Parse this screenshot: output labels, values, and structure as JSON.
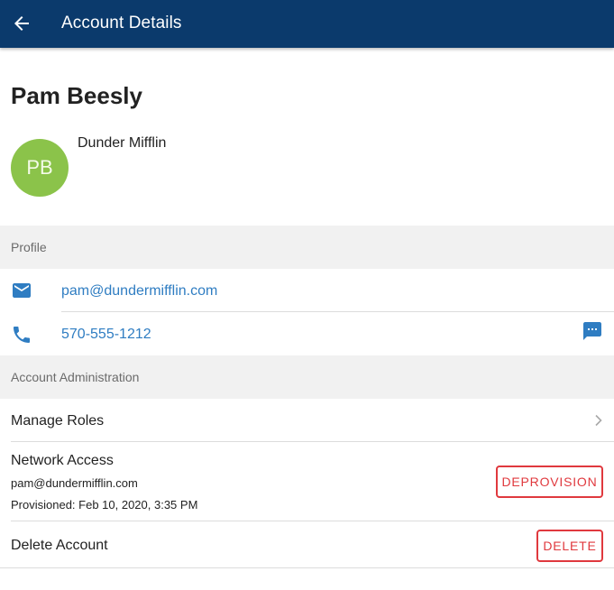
{
  "header": {
    "title": "Account Details"
  },
  "user": {
    "name": "Pam Beesly",
    "initials": "PB",
    "company": "Dunder Mifflin"
  },
  "profile": {
    "section_title": "Profile",
    "email": "pam@dundermifflin.com",
    "phone": "570-555-1212"
  },
  "admin": {
    "section_title": "Account Administration",
    "manage_roles_label": "Manage Roles",
    "network_access": {
      "label": "Network Access",
      "account": "pam@dundermifflin.com",
      "provisioned": "Provisioned: Feb 10, 2020, 3:35 PM",
      "button_label": "DEPROVISION"
    },
    "delete_account": {
      "label": "Delete Account",
      "button_label": "DELETE"
    }
  },
  "colors": {
    "appbar": "#0b3a6c",
    "avatar": "#8bc34a",
    "link": "#2f7dc2",
    "danger": "#e0393e"
  }
}
